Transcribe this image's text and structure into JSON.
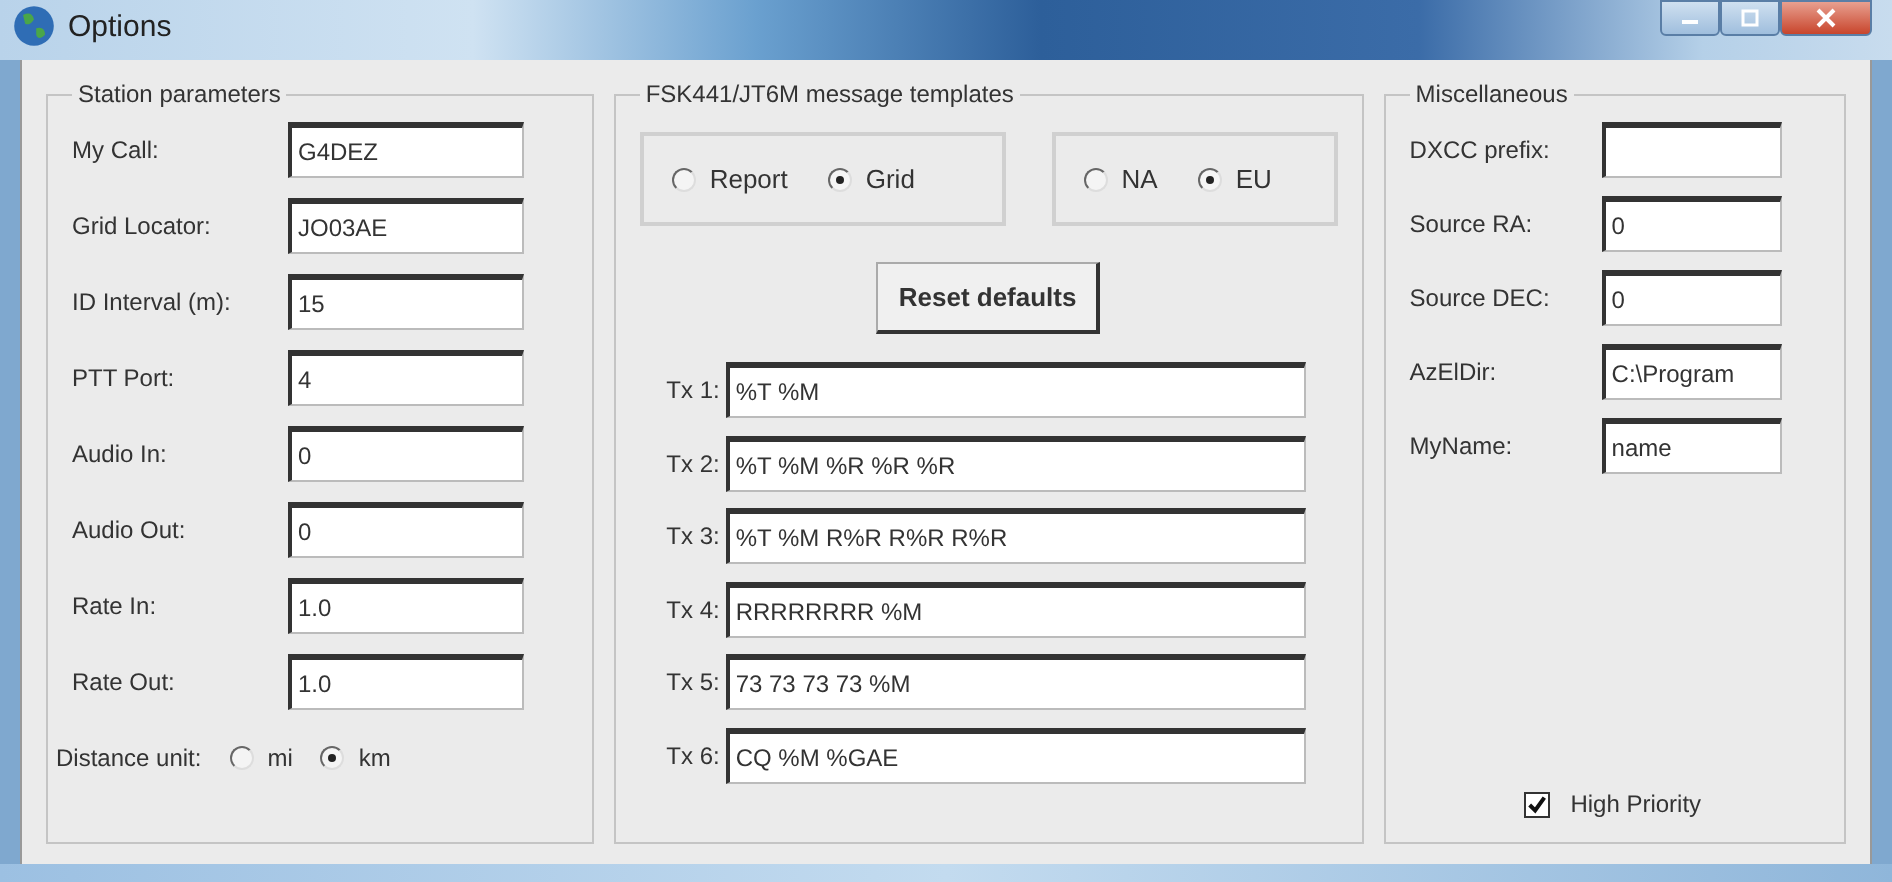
{
  "window": {
    "title": "Options"
  },
  "station": {
    "title": "Station parameters",
    "fields": [
      {
        "label": "My Call:",
        "value": "G4DEZ"
      },
      {
        "label": "Grid Locator:",
        "value": "JO03AE"
      },
      {
        "label": "ID Interval (m):",
        "value": "15"
      },
      {
        "label": "PTT Port:",
        "value": "4"
      },
      {
        "label": "Audio In:",
        "value": "0"
      },
      {
        "label": "Audio Out:",
        "value": "0"
      },
      {
        "label": "Rate In:",
        "value": "1.0"
      },
      {
        "label": "Rate Out:",
        "value": "1.0"
      }
    ],
    "distance_unit": {
      "label": "Distance unit:",
      "options": [
        {
          "label": "mi",
          "selected": false
        },
        {
          "label": "km",
          "selected": true
        }
      ]
    }
  },
  "templates": {
    "title": "FSK441/JT6M message templates",
    "radio_groups": [
      [
        {
          "label": "Report",
          "selected": false
        },
        {
          "label": "Grid",
          "selected": true
        }
      ],
      [
        {
          "label": "NA",
          "selected": false
        },
        {
          "label": "EU",
          "selected": true
        }
      ]
    ],
    "reset_button": "Reset defaults",
    "messages": [
      {
        "label": "Tx 1:",
        "value": "%T %M"
      },
      {
        "label": "Tx 2:",
        "value": "%T %M %R %R %R"
      },
      {
        "label": "Tx 3:",
        "value": "%T %M R%R R%R R%R"
      },
      {
        "label": "Tx 4:",
        "value": "RRRRRRRR %M"
      },
      {
        "label": "Tx 5:",
        "value": "73 73 73 73 %M"
      },
      {
        "label": "Tx 6:",
        "value": "CQ %M %GAE"
      }
    ]
  },
  "misc": {
    "title": "Miscellaneous",
    "fields": [
      {
        "label": "DXCC prefix:"
      },
      {
        "label": "Source RA:",
        "value": "0"
      },
      {
        "label": "Source DEC:",
        "value": "0"
      },
      {
        "label": "AzElDir:",
        "value": "C:\\Program"
      },
      {
        "label": "MyName:",
        "value": "name"
      }
    ],
    "high_priority": {
      "label": "High Priority",
      "checked": true
    }
  }
}
